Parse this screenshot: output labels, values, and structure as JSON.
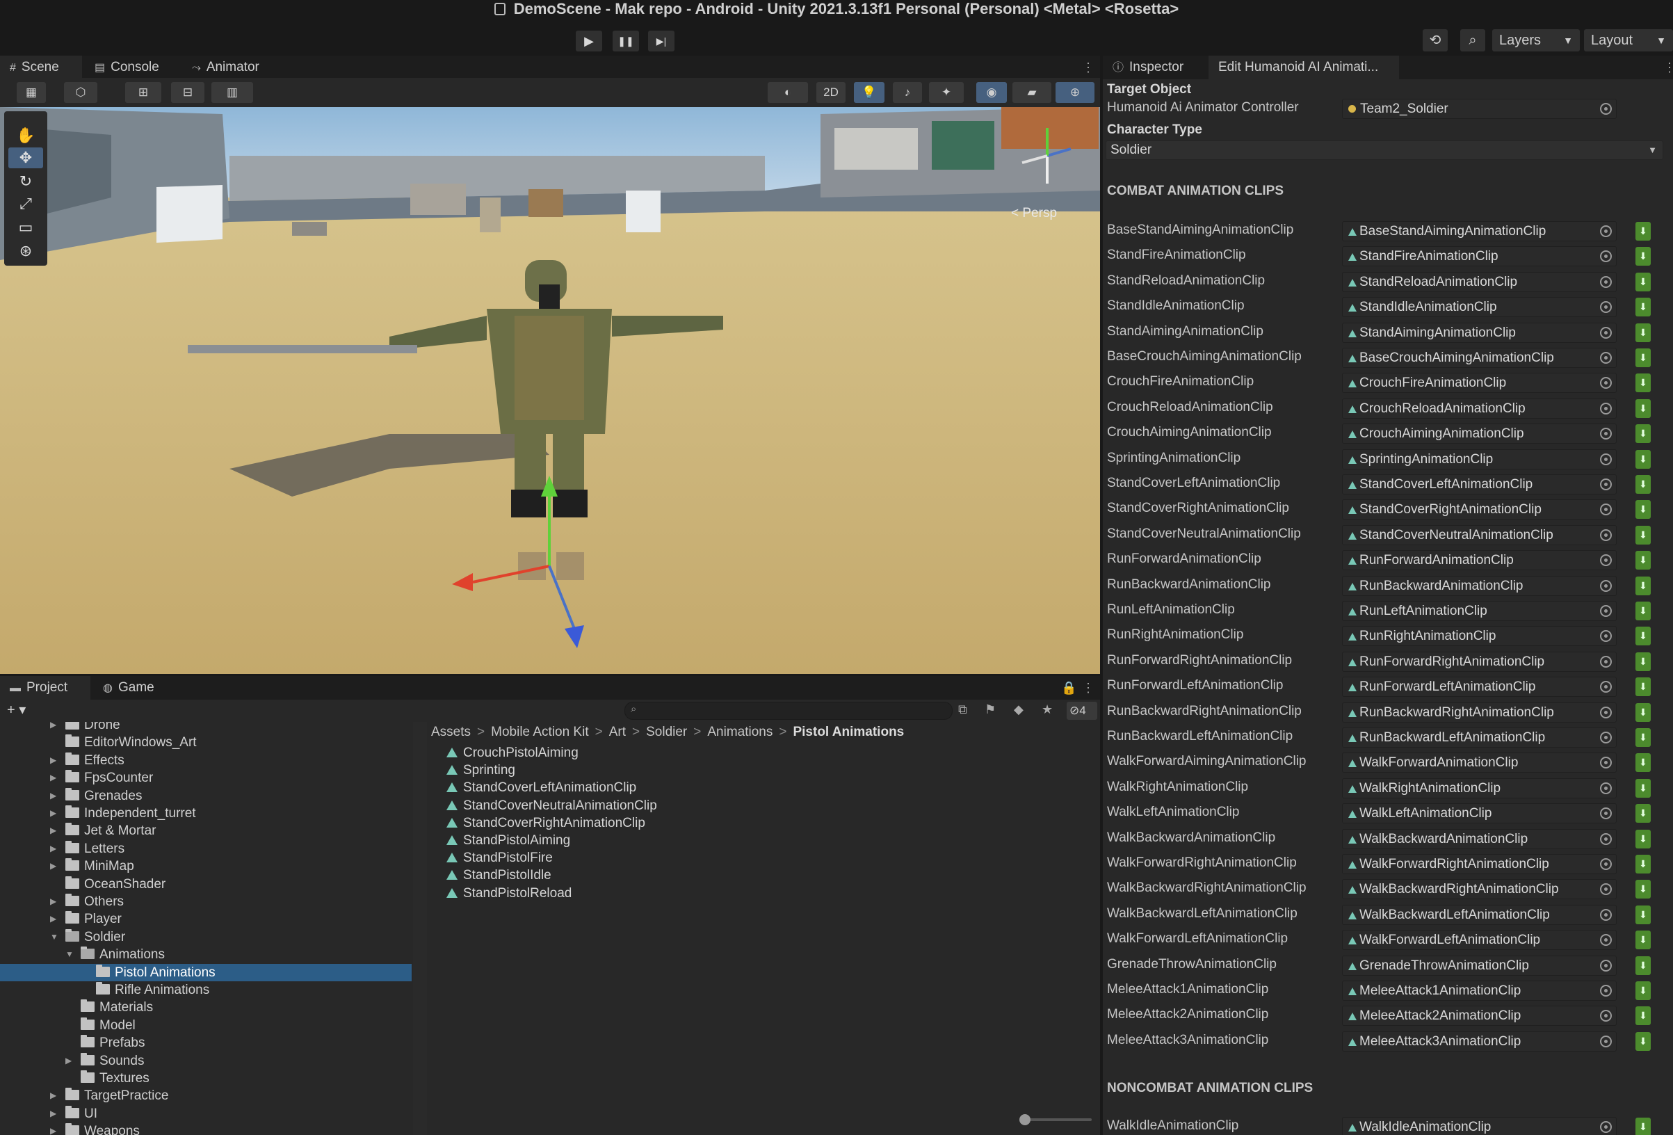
{
  "window": {
    "title": "DemoScene - Mak repo - Android - Unity 2021.3.13f1 Personal (Personal) <Metal> <Rosetta>"
  },
  "toolbar": {
    "play": "▶",
    "pause": "❚❚",
    "step": "▶|",
    "layers_label": "Layers",
    "layout_label": "Layout"
  },
  "scene_tabs": [
    {
      "label": "Scene",
      "icon": "grid-icon"
    },
    {
      "label": "Console",
      "icon": "console-icon"
    },
    {
      "label": "Animator",
      "icon": "animator-icon"
    }
  ],
  "scene_toolbar": {
    "mode_2d": "2D"
  },
  "scene_view": {
    "persp_label": "< Persp"
  },
  "project_tabs": [
    {
      "label": "Project",
      "icon": "folder-icon"
    },
    {
      "label": "Game",
      "icon": "gamepad-icon"
    }
  ],
  "project_toolbar": {
    "add": "+ ▾",
    "hidden_count": "4"
  },
  "project_tree": [
    {
      "label": "Drone",
      "indent": 0,
      "arrow": true,
      "open": false
    },
    {
      "label": "EditorWindows_Art",
      "indent": 0,
      "arrow": false,
      "open": false
    },
    {
      "label": "Effects",
      "indent": 0,
      "arrow": true,
      "open": false
    },
    {
      "label": "FpsCounter",
      "indent": 0,
      "arrow": true,
      "open": false
    },
    {
      "label": "Grenades",
      "indent": 0,
      "arrow": true,
      "open": false
    },
    {
      "label": "Independent_turret",
      "indent": 0,
      "arrow": true,
      "open": false
    },
    {
      "label": "Jet & Mortar",
      "indent": 0,
      "arrow": true,
      "open": false
    },
    {
      "label": "Letters",
      "indent": 0,
      "arrow": true,
      "open": false
    },
    {
      "label": "MiniMap",
      "indent": 0,
      "arrow": true,
      "open": false
    },
    {
      "label": "OceanShader",
      "indent": 0,
      "arrow": false,
      "open": false
    },
    {
      "label": "Others",
      "indent": 0,
      "arrow": true,
      "open": false
    },
    {
      "label": "Player",
      "indent": 0,
      "arrow": true,
      "open": false
    },
    {
      "label": "Soldier",
      "indent": 0,
      "arrow": true,
      "open": true
    },
    {
      "label": "Animations",
      "indent": 1,
      "arrow": true,
      "open": true
    },
    {
      "label": "Pistol Animations",
      "indent": 2,
      "arrow": false,
      "open": false,
      "selected": true
    },
    {
      "label": "Rifle Animations",
      "indent": 2,
      "arrow": false,
      "open": false
    },
    {
      "label": "Materials",
      "indent": 1,
      "arrow": false,
      "open": false
    },
    {
      "label": "Model",
      "indent": 1,
      "arrow": false,
      "open": false
    },
    {
      "label": "Prefabs",
      "indent": 1,
      "arrow": false,
      "open": false
    },
    {
      "label": "Sounds",
      "indent": 1,
      "arrow": true,
      "open": false
    },
    {
      "label": "Textures",
      "indent": 1,
      "arrow": false,
      "open": false
    },
    {
      "label": "TargetPractice",
      "indent": 0,
      "arrow": true,
      "open": false
    },
    {
      "label": "UI",
      "indent": 0,
      "arrow": true,
      "open": false
    },
    {
      "label": "Weapons",
      "indent": 0,
      "arrow": true,
      "open": false
    }
  ],
  "breadcrumb": [
    "Assets",
    "Mobile Action Kit",
    "Art",
    "Soldier",
    "Animations",
    "Pistol Animations"
  ],
  "project_files": [
    "CrouchPistolAiming",
    "Sprinting",
    "StandCoverLeftAnimationClip",
    "StandCoverNeutralAnimationClip",
    "StandCoverRightAnimationClip",
    "StandPistolAiming",
    "StandPistolFire",
    "StandPistolIdle",
    "StandPistolReload"
  ],
  "inspector_tabs": [
    {
      "label": "Inspector",
      "icon": "info-icon"
    },
    {
      "label": "Edit Humanoid AI Animati...",
      "icon": ""
    }
  ],
  "inspector": {
    "target_object_heading": "Target Object",
    "controller_label": "Humanoid Ai Animator Controller",
    "controller_value": "Team2_Soldier",
    "character_type_label": "Character Type",
    "character_type_value": "Soldier",
    "combat_heading": "COMBAT ANIMATION CLIPS",
    "noncombat_heading": "NONCOMBAT ANIMATION CLIPS",
    "combat_clips": [
      {
        "label": "BaseStandAimingAnimationClip",
        "value": "BaseStandAimingAnimationClip"
      },
      {
        "label": "StandFireAnimationClip",
        "value": "StandFireAnimationClip"
      },
      {
        "label": "StandReloadAnimationClip",
        "value": "StandReloadAnimationClip"
      },
      {
        "label": "StandIdleAnimationClip",
        "value": "StandIdleAnimationClip"
      },
      {
        "label": "StandAimingAnimationClip",
        "value": "StandAimingAnimationClip"
      },
      {
        "label": "BaseCrouchAimingAnimationClip",
        "value": "BaseCrouchAimingAnimationClip"
      },
      {
        "label": "CrouchFireAnimationClip",
        "value": "CrouchFireAnimationClip"
      },
      {
        "label": "CrouchReloadAnimationClip",
        "value": "CrouchReloadAnimationClip"
      },
      {
        "label": "CrouchAimingAnimationClip",
        "value": "CrouchAimingAnimationClip"
      },
      {
        "label": "SprintingAnimationClip",
        "value": "SprintingAnimationClip"
      },
      {
        "label": "StandCoverLeftAnimationClip",
        "value": "StandCoverLeftAnimationClip"
      },
      {
        "label": "StandCoverRightAnimationClip",
        "value": "StandCoverRightAnimationClip"
      },
      {
        "label": "StandCoverNeutralAnimationClip",
        "value": "StandCoverNeutralAnimationClip"
      },
      {
        "label": "RunForwardAnimationClip",
        "value": "RunForwardAnimationClip"
      },
      {
        "label": "RunBackwardAnimationClip",
        "value": "RunBackwardAnimationClip"
      },
      {
        "label": "RunLeftAnimationClip",
        "value": "RunLeftAnimationClip"
      },
      {
        "label": "RunRightAnimationClip",
        "value": "RunRightAnimationClip"
      },
      {
        "label": "RunForwardRightAnimationClip",
        "value": "RunForwardRightAnimationClip"
      },
      {
        "label": "RunForwardLeftAnimationClip",
        "value": "RunForwardLeftAnimationClip"
      },
      {
        "label": "RunBackwardRightAnimationClip",
        "value": "RunBackwardRightAnimationClip"
      },
      {
        "label": "RunBackwardLeftAnimationClip",
        "value": "RunBackwardLeftAnimationClip"
      },
      {
        "label": "WalkForwardAimingAnimationClip",
        "value": "WalkForwardAnimationClip"
      },
      {
        "label": "WalkRightAnimationClip",
        "value": "WalkRightAnimationClip"
      },
      {
        "label": "WalkLeftAnimationClip",
        "value": "WalkLeftAnimationClip"
      },
      {
        "label": "WalkBackwardAnimationClip",
        "value": "WalkBackwardAnimationClip"
      },
      {
        "label": "WalkForwardRightAnimationClip",
        "value": "WalkForwardRightAnimationClip"
      },
      {
        "label": "WalkBackwardRightAnimationClip",
        "value": "WalkBackwardRightAnimationClip"
      },
      {
        "label": "WalkBackwardLeftAnimationClip",
        "value": "WalkBackwardLeftAnimationClip"
      },
      {
        "label": "WalkForwardLeftAnimationClip",
        "value": "WalkForwardLeftAnimationClip"
      },
      {
        "label": "GrenadeThrowAnimationClip",
        "value": "GrenadeThrowAnimationClip"
      },
      {
        "label": "MeleeAttack1AnimationClip",
        "value": "MeleeAttack1AnimationClip"
      },
      {
        "label": "MeleeAttack2AnimationClip",
        "value": "MeleeAttack2AnimationClip"
      },
      {
        "label": "MeleeAttack3AnimationClip",
        "value": "MeleeAttack3AnimationClip"
      }
    ],
    "noncombat_clips": [
      {
        "label": "WalkIdleAnimationClip",
        "value": "WalkIdleAnimationClip"
      }
    ]
  },
  "colors": {
    "selection": "#2c5d87",
    "accent_blue": "#46607f",
    "clip_icon": "#79c8b6",
    "download_green": "#4c8b2d",
    "controller_dot": "#d9b64a"
  }
}
